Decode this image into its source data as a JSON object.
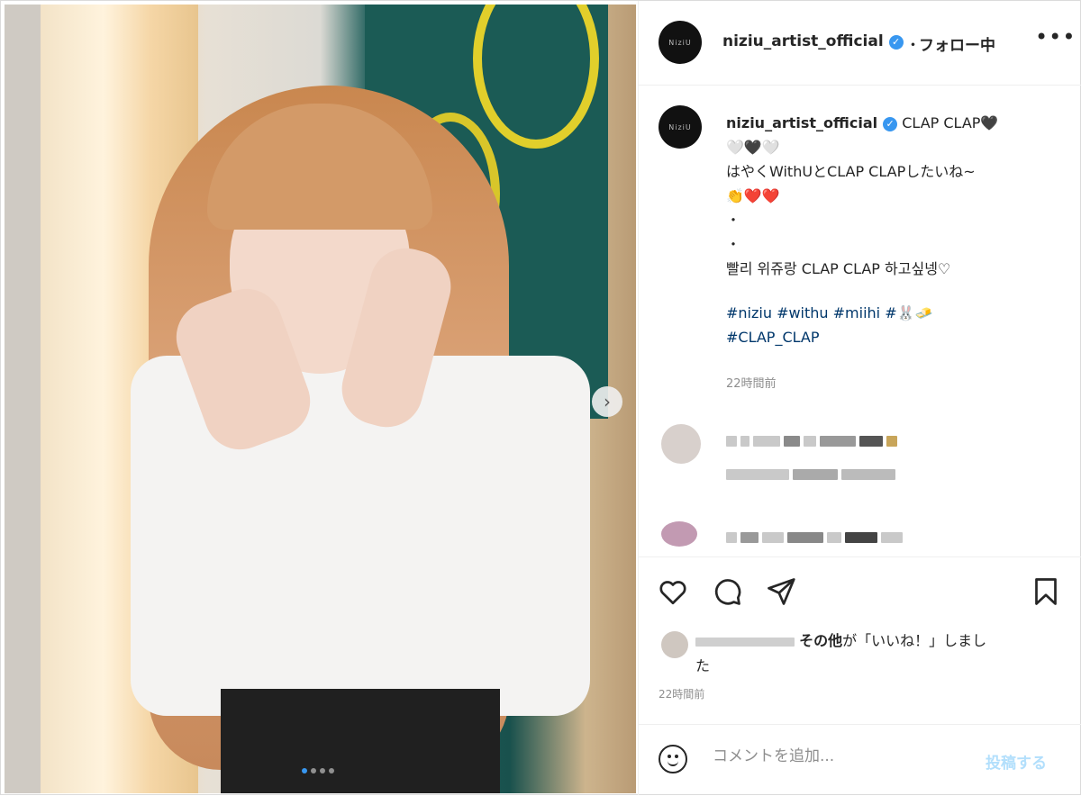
{
  "header": {
    "username": "niziu_artist_official",
    "verified_icon": "verified-check-icon",
    "separator": "・",
    "follow_label": "フォロー中",
    "more_icon": "more-horizontal-icon",
    "more_glyph": "•••"
  },
  "avatar": {
    "logo_text": "NiziU"
  },
  "caption": {
    "username": "niziu_artist_official",
    "line1": "CLAP CLAP🖤",
    "line2": "🤍🖤🤍",
    "line3": "はやくWithUとCLAP CLAPしたいね~",
    "line4": "👏❤️❤️",
    "line5": "・",
    "line6": "・",
    "line7": "빨리 위쥬랑 CLAP CLAP 하고싶넹♡",
    "hashtags_line1": "#niziu #withu #miihi #🐰🧈",
    "hashtags_line2": "#CLAP_CLAP",
    "time": "22時間前"
  },
  "actions": {
    "like_icon": "heart-icon",
    "comment_icon": "comment-icon",
    "share_icon": "paper-plane-icon",
    "save_icon": "bookmark-icon"
  },
  "likes": {
    "others_text": "その他",
    "suffix_text": "が「いいね！」しまし",
    "wrap_text": "た",
    "time": "22時間前"
  },
  "comment_box": {
    "placeholder": "コメントを追加...",
    "post_label": "投稿する"
  },
  "carousel": {
    "next_glyph": "›",
    "dot_count": 4,
    "active_dot": 0
  }
}
